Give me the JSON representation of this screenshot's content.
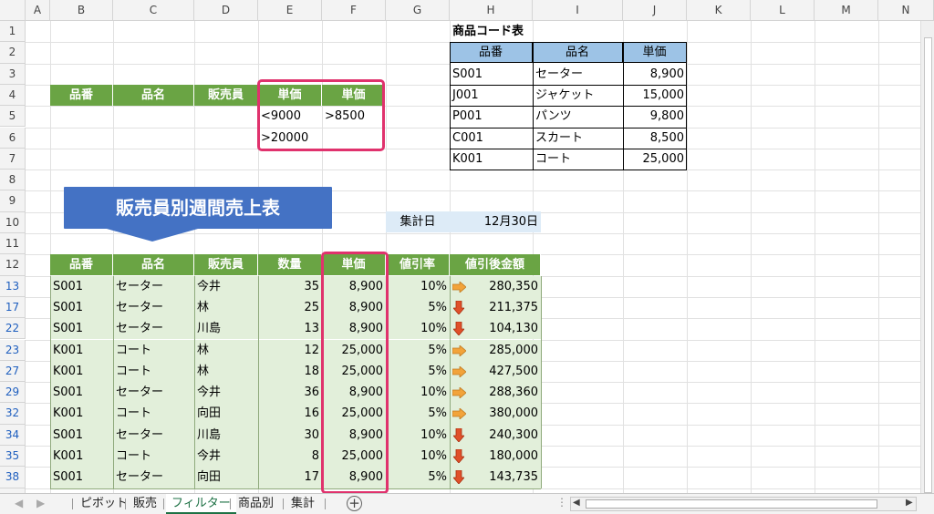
{
  "columns": [
    "A",
    "B",
    "C",
    "D",
    "E",
    "F",
    "G",
    "H",
    "I",
    "J",
    "K",
    "L",
    "M",
    "N"
  ],
  "rows": [
    "1",
    "2",
    "3",
    "4",
    "5",
    "6",
    "7",
    "8",
    "9",
    "10",
    "11",
    "12",
    "13",
    "17",
    "22",
    "23",
    "27",
    "29",
    "32",
    "34",
    "35",
    "38",
    ""
  ],
  "product_table": {
    "title": "商品コード表",
    "headers": [
      "品番",
      "品名",
      "単価"
    ],
    "rows": [
      [
        "S001",
        "セーター",
        "8,900"
      ],
      [
        "J001",
        "ジャケット",
        "15,000"
      ],
      [
        "P001",
        "パンツ",
        "9,800"
      ],
      [
        "C001",
        "スカート",
        "8,500"
      ],
      [
        "K001",
        "コート",
        "25,000"
      ]
    ]
  },
  "criteria": {
    "headers": [
      "品番",
      "品名",
      "販売員",
      "単価",
      "単価"
    ],
    "row1": [
      "<9000",
      ">8500"
    ],
    "row2": [
      ">20000"
    ]
  },
  "banner": {
    "title": "販売員別週間売上表"
  },
  "summary": {
    "label": "集計日",
    "value": "12月30日"
  },
  "sales": {
    "headers": [
      "品番",
      "品名",
      "販売員",
      "数量",
      "単価",
      "値引率",
      "値引後金額"
    ],
    "rows": [
      {
        "code": "S001",
        "name": "セーター",
        "seller": "今井",
        "qty": "35",
        "price": "8,900",
        "rate": "10%",
        "arrow": "right",
        "amount": "280,350"
      },
      {
        "code": "S001",
        "name": "セーター",
        "seller": "林",
        "qty": "25",
        "price": "8,900",
        "rate": "5%",
        "arrow": "down",
        "amount": "211,375"
      },
      {
        "code": "S001",
        "name": "セーター",
        "seller": "川島",
        "qty": "13",
        "price": "8,900",
        "rate": "10%",
        "arrow": "down",
        "amount": "104,130"
      },
      {
        "code": "K001",
        "name": "コート",
        "seller": "林",
        "qty": "12",
        "price": "25,000",
        "rate": "5%",
        "arrow": "right",
        "amount": "285,000"
      },
      {
        "code": "K001",
        "name": "コート",
        "seller": "林",
        "qty": "18",
        "price": "25,000",
        "rate": "5%",
        "arrow": "right",
        "amount": "427,500"
      },
      {
        "code": "S001",
        "name": "セーター",
        "seller": "今井",
        "qty": "36",
        "price": "8,900",
        "rate": "10%",
        "arrow": "right",
        "amount": "288,360"
      },
      {
        "code": "K001",
        "name": "コート",
        "seller": "向田",
        "qty": "16",
        "price": "25,000",
        "rate": "5%",
        "arrow": "right",
        "amount": "380,000"
      },
      {
        "code": "S001",
        "name": "セーター",
        "seller": "川島",
        "qty": "30",
        "price": "8,900",
        "rate": "10%",
        "arrow": "down",
        "amount": "240,300"
      },
      {
        "code": "K001",
        "name": "コート",
        "seller": "今井",
        "qty": "8",
        "price": "25,000",
        "rate": "10%",
        "arrow": "down",
        "amount": "180,000"
      },
      {
        "code": "S001",
        "name": "セーター",
        "seller": "向田",
        "qty": "17",
        "price": "8,900",
        "rate": "5%",
        "arrow": "down",
        "amount": "143,735"
      }
    ]
  },
  "sheet_tabs": [
    "ピボット",
    "販売",
    "フィルター",
    "商品別",
    "集計"
  ],
  "active_tab": "フィルター",
  "colors": {
    "header_green": "#6aa444",
    "row_green": "#e2efda",
    "header_blue": "#9dc3e6",
    "banner_blue": "#4472c4",
    "highlight_pink": "#e0326d",
    "arrow_orange": "#f2a33a",
    "arrow_red": "#e0502a"
  },
  "icons": {
    "add_sheet": "plus-circle-icon",
    "scroll_left": "chevron-left-icon",
    "scroll_right": "chevron-right-icon"
  }
}
